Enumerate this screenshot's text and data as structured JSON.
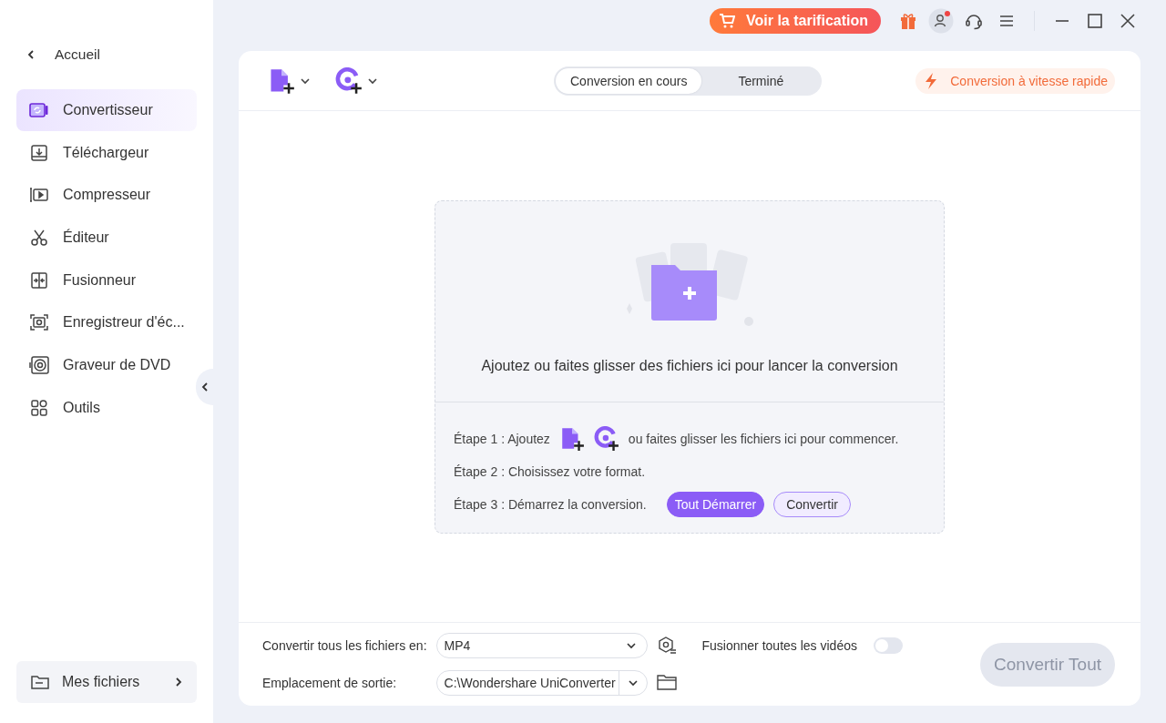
{
  "sidebar": {
    "back": {
      "label": "Accueil"
    },
    "items": [
      {
        "label": "Convertisseur",
        "kind": "converter",
        "selected": true
      },
      {
        "label": "Téléchargeur",
        "kind": "download",
        "selected": false
      },
      {
        "label": "Compresseur",
        "kind": "compress",
        "selected": false
      },
      {
        "label": "Éditeur",
        "kind": "editor",
        "selected": false
      },
      {
        "label": "Fusionneur",
        "kind": "merge",
        "selected": false
      },
      {
        "label": "Enregistreur d'éc...",
        "kind": "record",
        "selected": false
      },
      {
        "label": "Graveur de DVD",
        "kind": "dvd",
        "selected": false
      },
      {
        "label": "Outils",
        "kind": "tools",
        "selected": false
      }
    ],
    "footer": {
      "label": "Mes fichiers"
    }
  },
  "title_bar": {
    "pricing_button": "Voir la tarification"
  },
  "toolbar": {
    "tabs": [
      {
        "label": "Conversion en cours",
        "selected": true
      },
      {
        "label": "Terminé",
        "selected": false
      }
    ],
    "speed_badge": "Conversion à vitesse rapide"
  },
  "drop_zone": {
    "prompt": "Ajoutez ou faites glisser des fichiers ici pour lancer la conversion",
    "steps": [
      {
        "kind": "add",
        "before": "Étape 1 : Ajoutez",
        "after": "ou faites glisser les fichiers ici pour commencer."
      },
      {
        "kind": "text",
        "text": "Étape 2 : Choisissez votre format."
      },
      {
        "kind": "buttons",
        "text": "Étape 3 : Démarrez la conversion.",
        "buttons": [
          {
            "label": "Tout Démarrer",
            "kind": "primary"
          },
          {
            "label": "Convertir",
            "kind": "outline"
          }
        ]
      }
    ]
  },
  "bottom_bar": {
    "format_label": "Convertir tous les fichiers en:",
    "format_value": "MP4",
    "output_label": "Emplacement de sortie:",
    "output_value": "C:\\Wondershare UniConverter",
    "merge_label": "Fusionner toutes les vidéos",
    "merge_on": false,
    "convert_all": {
      "label": "Convertir Tout",
      "disabled": true
    }
  }
}
